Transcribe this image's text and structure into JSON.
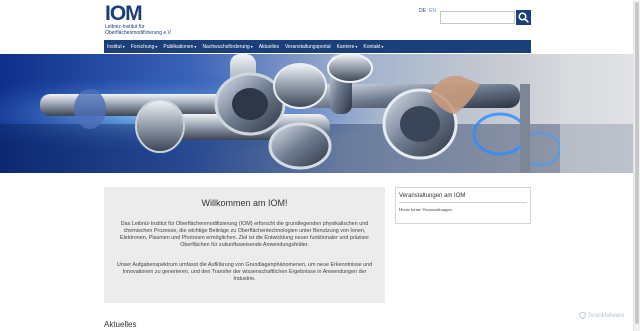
{
  "header": {
    "logo": {
      "mark": "IOM",
      "line1": "Leibniz-Institut für",
      "line2": "Oberflächenmodifizierung e.V."
    },
    "languages": [
      "DE",
      "EN"
    ],
    "search": {
      "placeholder": ""
    }
  },
  "nav": {
    "items": [
      {
        "label": "Institut",
        "dropdown": true
      },
      {
        "label": "Forschung",
        "dropdown": true
      },
      {
        "label": "Publikationen",
        "dropdown": true
      },
      {
        "label": "Nachwuchsförderung",
        "dropdown": true
      },
      {
        "label": "Aktuelles",
        "dropdown": false
      },
      {
        "label": "Veranstaltungsportal",
        "dropdown": false
      },
      {
        "label": "Karriere",
        "dropdown": true
      },
      {
        "label": "Kontakt",
        "dropdown": true
      }
    ],
    "caret": "▾"
  },
  "welcome": {
    "title": "Willkommen am IOM!",
    "paragraph1": "Das Leibniz-Institut für Oberflächenmodifizierung (IOM) erforscht die grundlegenden physikalischen und chemischen Prozesse, die wichtige Beiträge zu Oberflächentechnologien unter Benutzung von Ionen, Elektronen, Plasmen und Photonen ermöglichen. Ziel ist die Entwicklung neuer funktionaler und präziser Oberflächen für zukunftsweisende Anwendungsfelder.",
    "paragraph2": "Unser Aufgabenspektrum umfasst die Aufklärung von Grundlagenphänomenen, um neue Erkenntnisse und Innovationen zu generieren, und den Transfer der wissenschaftlichen Ergebnisse in Anwendungen der Industrie."
  },
  "events": {
    "title": "Veranstaltungen am IOM",
    "empty_text": "Heute keine Veranstaltungen."
  },
  "news": {
    "heading": "Aktuelles"
  },
  "watermark": {
    "text": "ScanMalware"
  },
  "colors": {
    "brand": "#1b3f78",
    "panel": "#ececec"
  },
  "icons": {
    "search": "search-icon",
    "watermark": "shield-icon"
  }
}
